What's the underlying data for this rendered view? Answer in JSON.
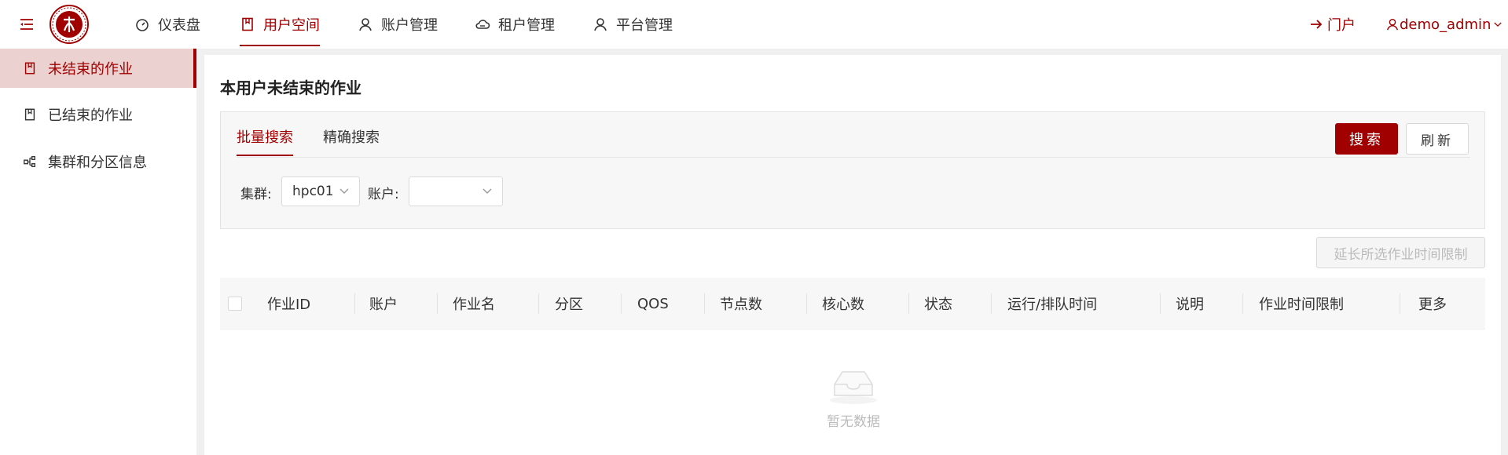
{
  "header": {
    "nav": [
      {
        "label": "仪表盘",
        "icon": "dashboard-icon"
      },
      {
        "label": "用户空间",
        "icon": "book-icon",
        "active": true
      },
      {
        "label": "账户管理",
        "icon": "user-icon"
      },
      {
        "label": "租户管理",
        "icon": "cloud-icon"
      },
      {
        "label": "平台管理",
        "icon": "user-icon"
      }
    ],
    "portal_label": "门户",
    "user_label": "demo_admin"
  },
  "sidebar": {
    "items": [
      {
        "label": "未结束的作业",
        "icon": "book-icon",
        "active": true
      },
      {
        "label": "已结束的作业",
        "icon": "book-icon"
      },
      {
        "label": "集群和分区信息",
        "icon": "cluster-icon"
      }
    ]
  },
  "main": {
    "title": "本用户未结束的作业",
    "tabs": [
      {
        "label": "批量搜索",
        "active": true
      },
      {
        "label": "精确搜索"
      }
    ],
    "search_button": "搜索",
    "refresh_button": "刷新",
    "filters": {
      "cluster_label": "集群:",
      "cluster_value": "hpc01",
      "account_label": "账户:",
      "account_value": ""
    },
    "extend_button": "延长所选作业时间限制",
    "table": {
      "columns": [
        "作业ID",
        "账户",
        "作业名",
        "分区",
        "QOS",
        "节点数",
        "核心数",
        "状态",
        "运行/排队时间",
        "说明",
        "作业时间限制",
        "更多"
      ],
      "rows": []
    },
    "empty_text": "暂无数据"
  },
  "colors": {
    "accent": "#a00000",
    "sidebar_active_bg": "#ebd2d0"
  }
}
